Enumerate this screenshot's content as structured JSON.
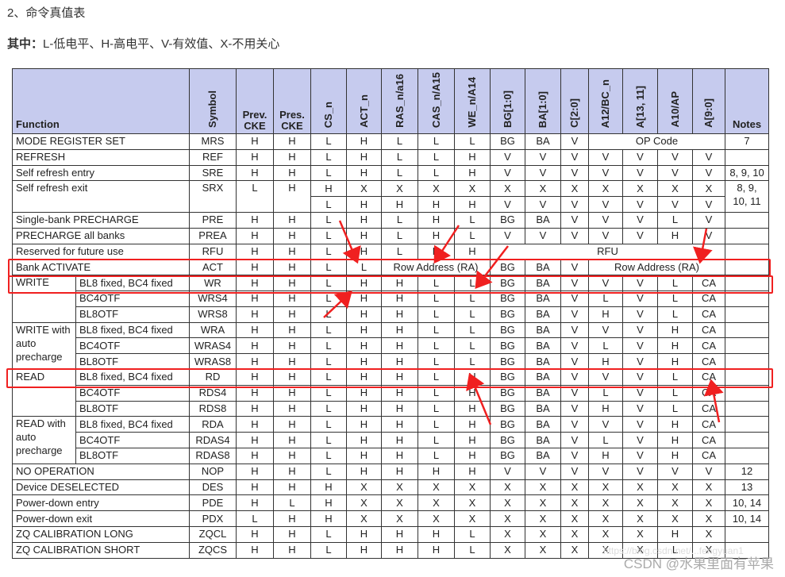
{
  "heading": "2、命令真值表",
  "legend": {
    "label": "其中：",
    "text": "L-低电平、H-高电平、V-有效值、X-不用关心"
  },
  "columns": [
    "Function",
    "Symbol",
    "Prev. CKE",
    "Pres. CKE",
    "CS_n",
    "ACT_n",
    "RAS_n/a16",
    "CAS_n/A15",
    "WE_n/A14",
    "BG[1:0]",
    "BA[1:0]",
    "C[2:0]",
    "A12/BC_n",
    "A[13, 11]",
    "A10/AP",
    "A[9:0]",
    "Notes"
  ],
  "rows": [
    {
      "func": "MODE REGISTER SET",
      "sym": "MRS",
      "vals": [
        "H",
        "H",
        "L",
        "H",
        "L",
        "L",
        "L",
        "BG",
        "BA",
        "V",
        {
          "t": "OP Code",
          "s": 4
        }
      ],
      "notes": "7"
    },
    {
      "func": "REFRESH",
      "sym": "REF",
      "vals": [
        "H",
        "H",
        "L",
        "H",
        "L",
        "L",
        "H",
        "V",
        "V",
        "V",
        "V",
        "V",
        "V",
        "V"
      ],
      "notes": ""
    },
    {
      "func": "Self refresh entry",
      "sym": "SRE",
      "vals": [
        "H",
        "H",
        "L",
        "H",
        "L",
        "L",
        "H",
        "V",
        "V",
        "V",
        "V",
        "V",
        "V",
        "V"
      ],
      "notes": "8, 9, 10"
    },
    {
      "func": "Self refresh exit",
      "sym": "SRX",
      "span": 2,
      "vals": [
        "L",
        "H",
        "H",
        "X",
        "X",
        "X",
        "X",
        "X",
        "X",
        "X",
        "X",
        "X",
        "X",
        "X"
      ],
      "notes": "8, 9, 10, 11"
    },
    {
      "cont": true,
      "vals": [
        "L",
        "H",
        "H",
        "H",
        "H",
        "V",
        "V",
        "V",
        "V",
        "V",
        "V",
        "V"
      ]
    },
    {
      "func": "Single-bank PRECHARGE",
      "sym": "PRE",
      "vals": [
        "H",
        "H",
        "L",
        "H",
        "L",
        "H",
        "L",
        "BG",
        "BA",
        "V",
        "V",
        "V",
        "L",
        "V"
      ],
      "notes": ""
    },
    {
      "func": "PRECHARGE all banks",
      "sym": "PREA",
      "vals": [
        "H",
        "H",
        "L",
        "H",
        "L",
        "H",
        "L",
        "V",
        "V",
        "V",
        "V",
        "V",
        "H",
        "V"
      ],
      "notes": ""
    },
    {
      "func": "Reserved for future use",
      "sym": "RFU",
      "vals": [
        "H",
        "H",
        "L",
        "H",
        "L",
        "H",
        "H",
        {
          "t": "RFU",
          "s": 7
        }
      ],
      "notes": ""
    },
    {
      "func": "Bank ACTIVATE",
      "sym": "ACT",
      "vals": [
        "H",
        "H",
        "L",
        "L",
        {
          "t": "Row Address (RA)",
          "s": 3
        },
        "BG",
        "BA",
        "V",
        {
          "t": "Row Address (RA)",
          "s": 4
        }
      ],
      "notes": ""
    },
    {
      "group": "WRITE",
      "gspan": 3,
      "sub": "BL8 fixed, BC4 fixed",
      "sym": "WR",
      "vals": [
        "H",
        "H",
        "L",
        "H",
        "H",
        "L",
        "L",
        "BG",
        "BA",
        "V",
        "V",
        "V",
        "L",
        "CA"
      ],
      "notes": ""
    },
    {
      "sub": "BC4OTF",
      "sym": "WRS4",
      "vals": [
        "H",
        "H",
        "L",
        "H",
        "H",
        "L",
        "L",
        "BG",
        "BA",
        "V",
        "L",
        "V",
        "L",
        "CA"
      ],
      "notes": ""
    },
    {
      "sub": "BL8OTF",
      "sym": "WRS8",
      "vals": [
        "H",
        "H",
        "L",
        "H",
        "H",
        "L",
        "L",
        "BG",
        "BA",
        "V",
        "H",
        "V",
        "L",
        "CA"
      ],
      "notes": ""
    },
    {
      "group": "WRITE with auto precharge",
      "gspan": 3,
      "sub": "BL8 fixed, BC4 fixed",
      "sym": "WRA",
      "vals": [
        "H",
        "H",
        "L",
        "H",
        "H",
        "L",
        "L",
        "BG",
        "BA",
        "V",
        "V",
        "V",
        "H",
        "CA"
      ],
      "notes": ""
    },
    {
      "sub": "BC4OTF",
      "sym": "WRAS4",
      "vals": [
        "H",
        "H",
        "L",
        "H",
        "H",
        "L",
        "L",
        "BG",
        "BA",
        "V",
        "L",
        "V",
        "H",
        "CA"
      ],
      "notes": ""
    },
    {
      "sub": "BL8OTF",
      "sym": "WRAS8",
      "vals": [
        "H",
        "H",
        "L",
        "H",
        "H",
        "L",
        "L",
        "BG",
        "BA",
        "V",
        "H",
        "V",
        "H",
        "CA"
      ],
      "notes": ""
    },
    {
      "group": "READ",
      "gspan": 3,
      "sub": "BL8 fixed, BC4 fixed",
      "sym": "RD",
      "vals": [
        "H",
        "H",
        "L",
        "H",
        "H",
        "L",
        "H",
        "BG",
        "BA",
        "V",
        "V",
        "V",
        "L",
        "CA"
      ],
      "notes": ""
    },
    {
      "sub": "BC4OTF",
      "sym": "RDS4",
      "vals": [
        "H",
        "H",
        "L",
        "H",
        "H",
        "L",
        "H",
        "BG",
        "BA",
        "V",
        "L",
        "V",
        "L",
        "CA"
      ],
      "notes": ""
    },
    {
      "sub": "BL8OTF",
      "sym": "RDS8",
      "vals": [
        "H",
        "H",
        "L",
        "H",
        "H",
        "L",
        "H",
        "BG",
        "BA",
        "V",
        "H",
        "V",
        "L",
        "CA"
      ],
      "notes": ""
    },
    {
      "group": "READ with auto precharge",
      "gspan": 3,
      "sub": "BL8 fixed, BC4 fixed",
      "sym": "RDA",
      "vals": [
        "H",
        "H",
        "L",
        "H",
        "H",
        "L",
        "H",
        "BG",
        "BA",
        "V",
        "V",
        "V",
        "H",
        "CA"
      ],
      "notes": ""
    },
    {
      "sub": "BC4OTF",
      "sym": "RDAS4",
      "vals": [
        "H",
        "H",
        "L",
        "H",
        "H",
        "L",
        "H",
        "BG",
        "BA",
        "V",
        "L",
        "V",
        "H",
        "CA"
      ],
      "notes": ""
    },
    {
      "sub": "BL8OTF",
      "sym": "RDAS8",
      "vals": [
        "H",
        "H",
        "L",
        "H",
        "H",
        "L",
        "H",
        "BG",
        "BA",
        "V",
        "H",
        "V",
        "H",
        "CA"
      ],
      "notes": ""
    },
    {
      "func": "NO OPERATION",
      "sym": "NOP",
      "vals": [
        "H",
        "H",
        "L",
        "H",
        "H",
        "H",
        "H",
        "V",
        "V",
        "V",
        "V",
        "V",
        "V",
        "V"
      ],
      "notes": "12"
    },
    {
      "func": "Device DESELECTED",
      "sym": "DES",
      "vals": [
        "H",
        "H",
        "H",
        "X",
        "X",
        "X",
        "X",
        "X",
        "X",
        "X",
        "X",
        "X",
        "X",
        "X"
      ],
      "notes": "13"
    },
    {
      "func": "Power-down entry",
      "sym": "PDE",
      "vals": [
        "H",
        "L",
        "H",
        "X",
        "X",
        "X",
        "X",
        "X",
        "X",
        "X",
        "X",
        "X",
        "X",
        "X"
      ],
      "notes": "10, 14"
    },
    {
      "func": "Power-down exit",
      "sym": "PDX",
      "vals": [
        "L",
        "H",
        "H",
        "X",
        "X",
        "X",
        "X",
        "X",
        "X",
        "X",
        "X",
        "X",
        "X",
        "X"
      ],
      "notes": "10, 14"
    },
    {
      "func": "ZQ CALIBRATION LONG",
      "sym": "ZQCL",
      "vals": [
        "H",
        "H",
        "L",
        "H",
        "H",
        "H",
        "L",
        "X",
        "X",
        "X",
        "X",
        "X",
        "H",
        "X"
      ],
      "notes": ""
    },
    {
      "func": "ZQ CALIBRATION SHORT",
      "sym": "ZQCS",
      "vals": [
        "H",
        "H",
        "L",
        "H",
        "H",
        "H",
        "L",
        "X",
        "X",
        "X",
        "X",
        "X",
        "L",
        "X"
      ],
      "notes": ""
    }
  ],
  "highlight_color": "#f02020",
  "header_bg": "#c6cbee",
  "watermark": "CSDN @水果里面有苹果",
  "watermark_url": "https://blog.csdn.net/...fengyuan1"
}
